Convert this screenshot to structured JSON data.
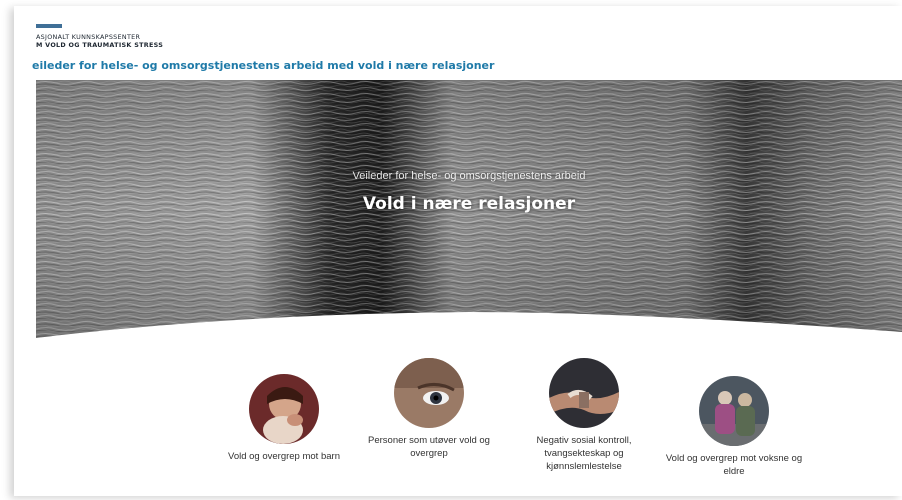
{
  "logo": {
    "line1": "ASJONALT KUNNSKAPSSENTER",
    "line2": "M VOLD OG TRAUMATISK STRESS"
  },
  "header": {
    "site_title": "eileder for helse- og omsorgstjenestens arbeid med vold i nære relasjoner"
  },
  "hero": {
    "subtitle": "Veileder for helse- og omsorgstjenestens arbeid",
    "title": "Vold i nære relasjoner"
  },
  "categories": [
    {
      "label": "Vold og overgrep mot barn"
    },
    {
      "label": "Personer som utøver vold og overgrep"
    },
    {
      "label": "Negativ sosial kontroll, tvangsekteskap og kjønnslemlestelse"
    },
    {
      "label": "Vold og overgrep mot voksne og eldre"
    }
  ],
  "colors": {
    "accent": "#1f7aa8",
    "logo_bar": "#3f6f97"
  }
}
